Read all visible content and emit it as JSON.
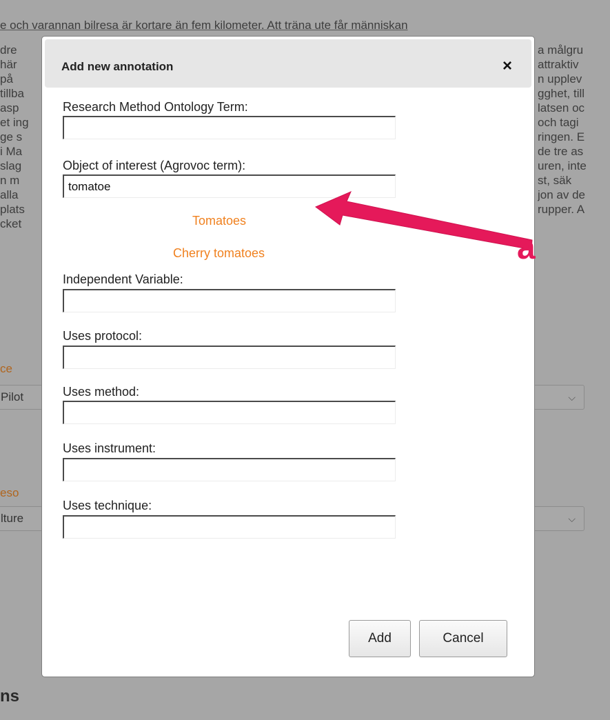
{
  "background": {
    "top_line": "e och varannan bilresa är kortare än fem kilometer. Att träna ute får människan",
    "left_fragments": [
      "dre",
      "här",
      "på",
      "tillba",
      "asp",
      "et ing",
      "ge s",
      "i Ma",
      "slag",
      "n m",
      "alla",
      "plats",
      "cket"
    ],
    "right_fragments": [
      "a målgru",
      "attraktiv",
      "n upplev",
      "gghet, till",
      "latsen oc",
      "och tagi",
      "ringen. E",
      "de tre as",
      "uren, inte",
      "st, säk",
      "jon av de",
      "rupper. A"
    ],
    "orange_label_1": "ce",
    "select_1_value": "Pilot",
    "orange_label_2": "eso",
    "select_2_value": "lture",
    "section_heading": "ns"
  },
  "modal": {
    "title": "Add new annotation",
    "close_icon": "×",
    "fields": {
      "research_method_label": "Research Method Ontology Term:",
      "research_method_value": "",
      "object_of_interest_label": "Object of interest (Agrovoc term):",
      "object_of_interest_value": "tomatoe",
      "independent_variable_label": "Independent Variable:",
      "independent_variable_value": "",
      "uses_protocol_label": "Uses protocol:",
      "uses_protocol_value": "",
      "uses_method_label": "Uses method:",
      "uses_method_value": "",
      "uses_instrument_label": "Uses instrument:",
      "uses_instrument_value": "",
      "uses_technique_label": "Uses technique:",
      "uses_technique_value": ""
    },
    "suggestions": [
      "Tomatoes",
      "Cherry tomatoes"
    ],
    "buttons": {
      "add": "Add",
      "cancel": "Cancel"
    }
  },
  "annotation": {
    "callout_letter": "a",
    "arrow_color": "#e5195a"
  },
  "colors": {
    "suggestion": "#f0811f",
    "overlay": "#a6a6a6",
    "header": "#e6e6e6"
  }
}
